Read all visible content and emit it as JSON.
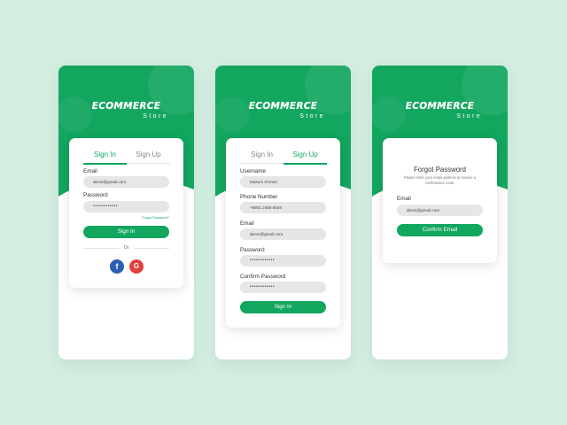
{
  "colors": {
    "background": "#d4eee2",
    "brand": "#13a65f",
    "facebook": "#2d5fb0",
    "google": "#e0403e"
  },
  "logo": {
    "main": "ECOMMERCE",
    "sub": "Store"
  },
  "screens": {
    "signin": {
      "tabs": [
        {
          "label": "Sign In",
          "active": true
        },
        {
          "label": "Sign Up",
          "active": false
        }
      ],
      "email_label": "Email",
      "email_value": "demo@gmail.com",
      "password_label": "Password",
      "password_value": "••••••••••••",
      "forgot_link": "Forgot Password?",
      "submit": "Sign In",
      "divider": "Or",
      "social": [
        {
          "icon": "facebook-icon",
          "glyph": "f"
        },
        {
          "icon": "google-icon",
          "glyph": "G"
        }
      ]
    },
    "signup": {
      "tabs": [
        {
          "label": "Sign In",
          "active": false
        },
        {
          "label": "Sign Up",
          "active": true
        }
      ],
      "username_label": "Username",
      "username_value": "Masum Ahmed",
      "phone_label": "Phone Number",
      "phone_value": "+8801 2458 5548",
      "email_label": "Email",
      "email_value": "demo@gmail.com",
      "password_label": "Password",
      "password_value": "••••••••••••",
      "confirm_label": "Confirm Password",
      "confirm_value": "••••••••••••",
      "submit": "Sign In"
    },
    "forgot": {
      "title": "Forgot Password",
      "description": "Please enter your email address to receive a confirmation code.",
      "email_label": "Email",
      "email_value": "demo@gmail.com",
      "submit": "Confirm Email"
    }
  }
}
